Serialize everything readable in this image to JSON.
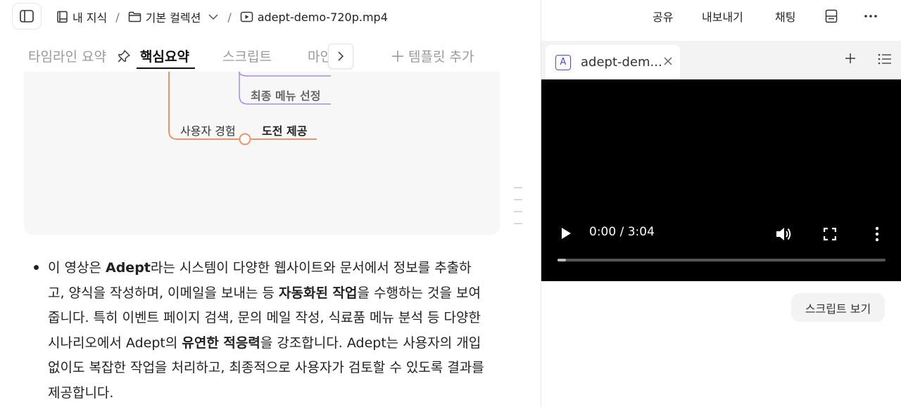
{
  "breadcrumb": {
    "knowledge": "내 지식",
    "collection": "기본 컬렉션",
    "file": "adept-demo-720p.mp4"
  },
  "top_actions": {
    "share": "공유",
    "export": "내보내기",
    "chat": "채팅"
  },
  "tabs": {
    "timeline": "타임라인 요약",
    "core": "핵심요약",
    "script": "스크립트",
    "mindmap": "마인",
    "add_template": "템플릿 추가"
  },
  "mindmap": {
    "node_top": "최종 메뉴 선정",
    "branch": "사용자 경험",
    "node_bottom": "도전 제공"
  },
  "summary": {
    "t1": "이 영상은 ",
    "b1": "Adept",
    "t2": "라는 시스템이 다양한 웹사이트와 문서에서 정보를 추출하고, 양식을 작성하며, 이메일을 보내는 등 ",
    "b2": "자동화된 작업",
    "t3": "을 수행하는 것을 보여줍니다. 특히 이벤트 페이지 검색, 문의 메일 작성, 식료품 메뉴 분석 등 다양한 시나리오에서 Adept의 ",
    "b3": "유연한 적응력",
    "t4": "을 강조합니다. Adept는 사용자의 개입 없이도 복잡한 작업을 처리하고, 최종적으로 사용자가 검토할 수 있도록 결과를 제공합니다."
  },
  "right_panel": {
    "tab_badge": "A",
    "tab_title": "adept-dem...",
    "video_time": "0:00 / 3:04",
    "video_progress": 0.0,
    "script_button": "스크립트 보기"
  },
  "colors": {
    "accent_orange": "#e8956a",
    "accent_purple": "#a48cf0",
    "badge_blue": "#4a4ad0"
  }
}
